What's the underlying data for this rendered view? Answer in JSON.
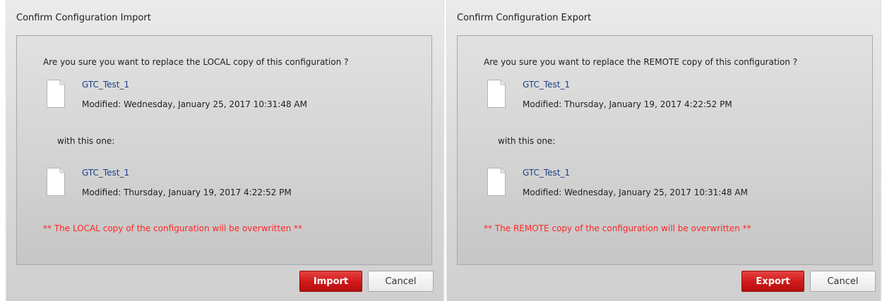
{
  "dialogs": [
    {
      "title": "Confirm Configuration Import",
      "question": "Are you sure you want to replace the LOCAL copy of this configuration ?",
      "current_file": {
        "name": "GTC_Test_1",
        "modified": "Modified: Wednesday, January 25, 2017 10:31:48 AM"
      },
      "with_text": "with this one:",
      "new_file": {
        "name": "GTC_Test_1",
        "modified": "Modified: Thursday, January 19, 2017 4:22:52 PM"
      },
      "warning": "** The LOCAL copy of the configuration will be overwritten **",
      "primary_button": "Import",
      "cancel_button": "Cancel"
    },
    {
      "title": "Confirm Configuration Export",
      "question": "Are you sure you want to replace the REMOTE copy of this configuration ?",
      "current_file": {
        "name": "GTC_Test_1",
        "modified": "Modified: Thursday, January 19, 2017 4:22:52 PM"
      },
      "with_text": "with this one:",
      "new_file": {
        "name": "GTC_Test_1",
        "modified": "Modified: Wednesday, January 25, 2017 10:31:48 AM"
      },
      "warning": "** The REMOTE copy of the configuration will be overwritten **",
      "primary_button": "Export",
      "cancel_button": "Cancel"
    }
  ],
  "colors": {
    "file_name": "#1f3f8a",
    "warning": "#ff2525",
    "primary_button": "#d01818"
  },
  "icons": {
    "file": "document-icon"
  }
}
